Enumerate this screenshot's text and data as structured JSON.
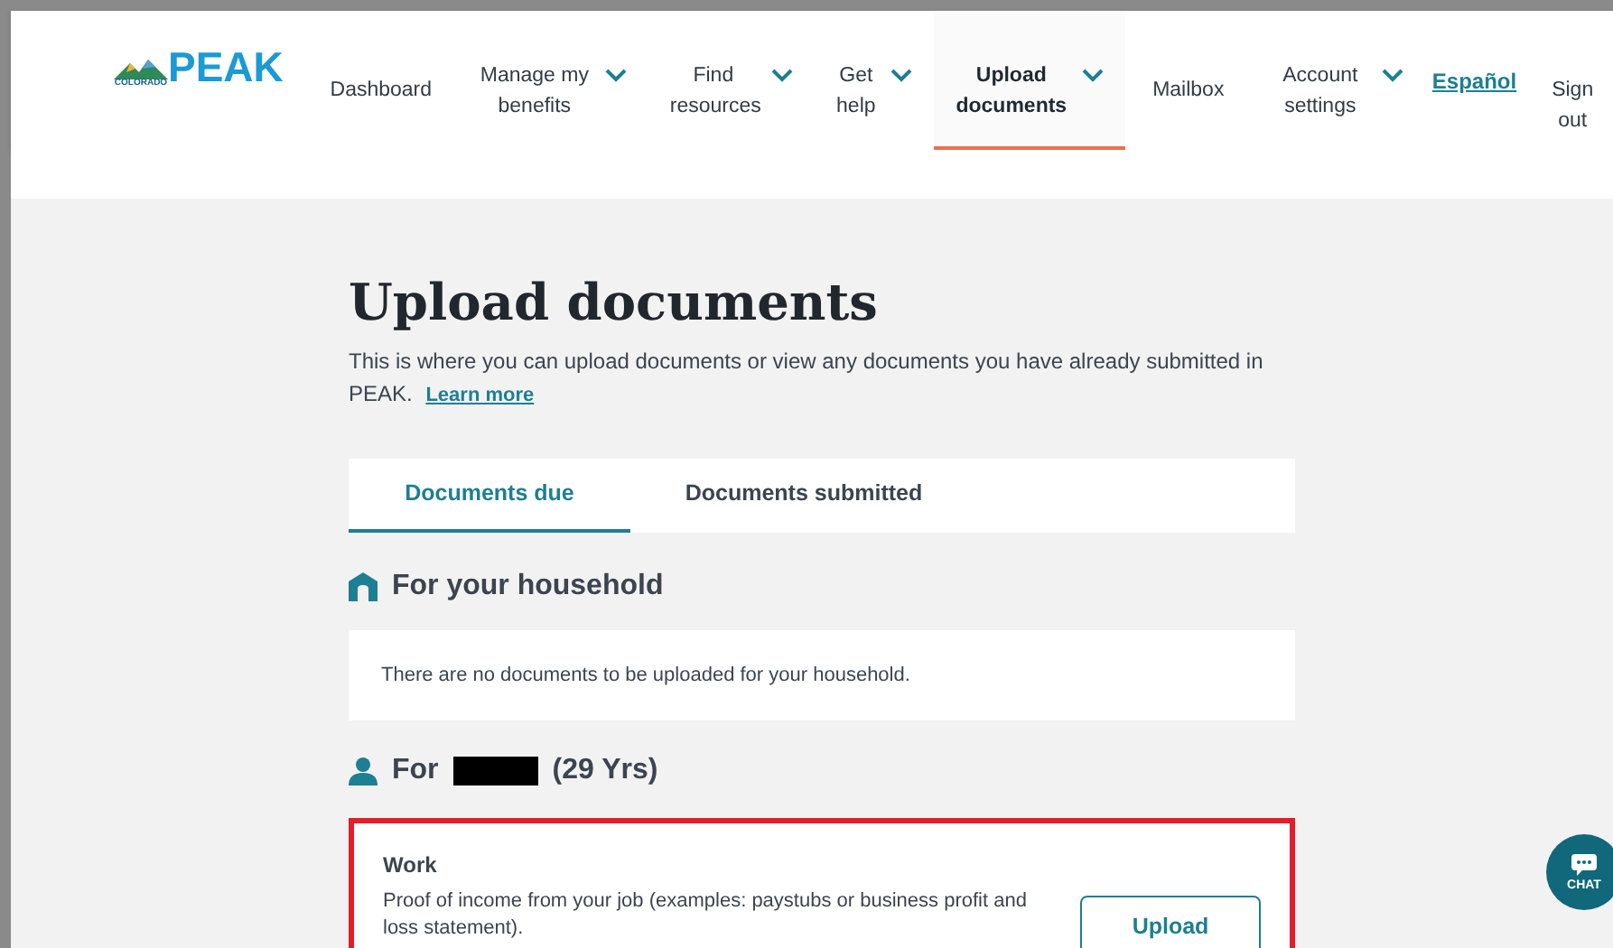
{
  "logo": {
    "small": "COLORADO",
    "big": "PEAK"
  },
  "nav": [
    {
      "label": "Dashboard",
      "kind": "item",
      "dropdown": false,
      "selected": false
    },
    {
      "label": "Manage my benefits",
      "kind": "item",
      "dropdown": true,
      "selected": false
    },
    {
      "label": "Find resources",
      "kind": "item",
      "dropdown": true,
      "selected": false
    },
    {
      "label": "Get help",
      "kind": "item",
      "dropdown": true,
      "selected": false
    },
    {
      "label": "Upload documents",
      "kind": "item",
      "dropdown": true,
      "selected": true
    },
    {
      "label": "Mailbox",
      "kind": "item",
      "dropdown": false,
      "selected": false
    },
    {
      "label": "Account settings",
      "kind": "item",
      "dropdown": true,
      "selected": false
    },
    {
      "label": "Español",
      "kind": "link"
    },
    {
      "label": "Sign out",
      "kind": "item",
      "dropdown": false,
      "selected": false
    }
  ],
  "page": {
    "title": "Upload documents",
    "intro": "This is where you can upload documents or view any documents you have already submitted in PEAK.",
    "learn_more": "Learn more"
  },
  "tabs": [
    {
      "label": "Documents due",
      "selected": true
    },
    {
      "label": "Documents submitted",
      "selected": false
    }
  ],
  "household": {
    "heading": "For your household",
    "message": "There are no documents to be uploaded for your household."
  },
  "person": {
    "prefix": "For",
    "name_redacted": true,
    "suffix": "(29 Yrs)"
  },
  "documents": [
    {
      "title": "Work",
      "description": "Proof of income from your job (examples: paystubs or business profit and loss statement).",
      "button": "Upload",
      "highlighted": true
    }
  ],
  "chat": {
    "label": "CHAT"
  }
}
